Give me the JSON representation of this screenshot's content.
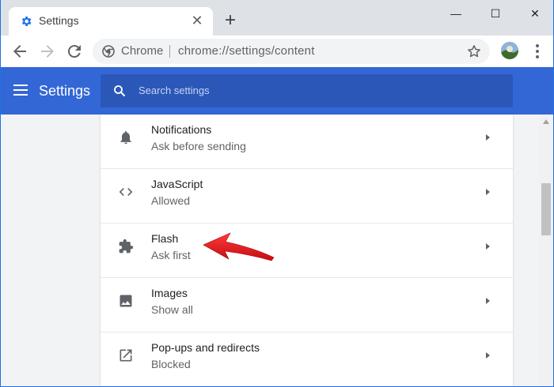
{
  "browser": {
    "tab_title": "Settings",
    "tab_close": "✕",
    "new_tab": "+",
    "window_controls": {
      "minimize": "—",
      "maximize": "☐",
      "close": "✕"
    },
    "omnibox": {
      "label": "Chrome",
      "url": "chrome://settings/content"
    }
  },
  "header": {
    "title": "Settings",
    "search_placeholder": "Search settings"
  },
  "settings_rows": [
    {
      "title": "Notifications",
      "subtitle": "Ask before sending",
      "icon": "bell-icon"
    },
    {
      "title": "JavaScript",
      "subtitle": "Allowed",
      "icon": "code-icon"
    },
    {
      "title": "Flash",
      "subtitle": "Ask first",
      "icon": "puzzle-icon"
    },
    {
      "title": "Images",
      "subtitle": "Show all",
      "icon": "image-icon"
    },
    {
      "title": "Pop-ups and redirects",
      "subtitle": "Blocked",
      "icon": "popout-icon"
    }
  ],
  "colors": {
    "header_blue": "#3367d6",
    "search_blue": "#2b58b8",
    "annotation_red": "#e8141b"
  }
}
